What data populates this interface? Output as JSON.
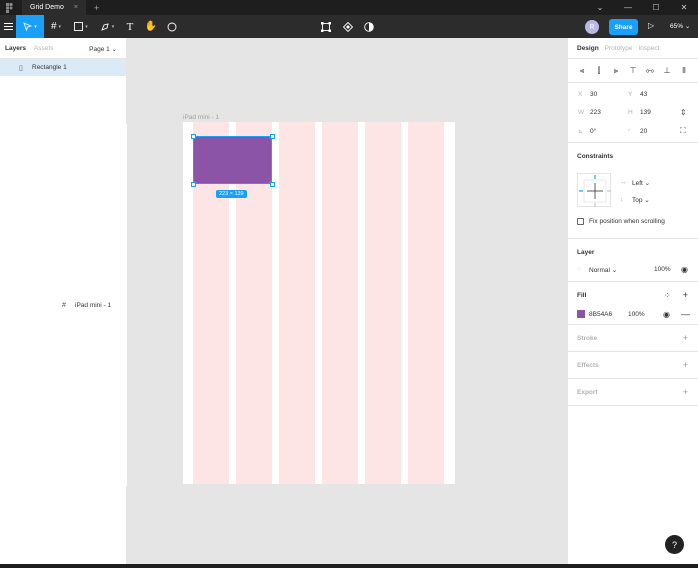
{
  "titlebar": {
    "file_name": "Grid Demo",
    "close_glyph": "×",
    "add_glyph": "+",
    "min": "—",
    "max": "☐",
    "close": "✕",
    "menu_caret": "⌄"
  },
  "toolbar": {
    "avatar_initial": "R",
    "share_label": "Share",
    "play_glyph": "▷",
    "zoom_label": "65% ⌄"
  },
  "left_panel": {
    "tabs": [
      "Layers",
      "Assets"
    ],
    "page_selector": "Page 1 ⌄",
    "layers": [
      {
        "icon": "#",
        "label": "iPad mini - 1"
      },
      {
        "icon": "▯",
        "label": "Rectangle 1"
      }
    ]
  },
  "canvas": {
    "frame_label": "iPad mini - 1",
    "selection_dimensions": "223 × 139",
    "fill_color": "#8B54A6",
    "grid_color": "#FDE5E5",
    "accent": "#18A0FB"
  },
  "right_panel": {
    "tabs": [
      "Design",
      "Prototype",
      "Inspect"
    ],
    "x_label": "X",
    "x": "30",
    "y_label": "Y",
    "y": "43",
    "w_label": "W",
    "w": "223",
    "h_label": "H",
    "h": "139",
    "rotation_label": "⊾",
    "rotation": "0°",
    "radius_label": "◜",
    "radius": "20",
    "constraints_title": "Constraints",
    "horizontal_constraint": "Left ⌄",
    "vertical_constraint": "Top ⌄",
    "fix_position": "Fix position when scrolling",
    "layer_title": "Layer",
    "blend_mode": "Normal ⌄",
    "layer_opacity": "100%",
    "fill_title": "Fill",
    "fill_hex": "8B54A6",
    "fill_opacity": "100%",
    "stroke_title": "Stroke",
    "effects_title": "Effects",
    "export_title": "Export"
  },
  "help_label": "?"
}
